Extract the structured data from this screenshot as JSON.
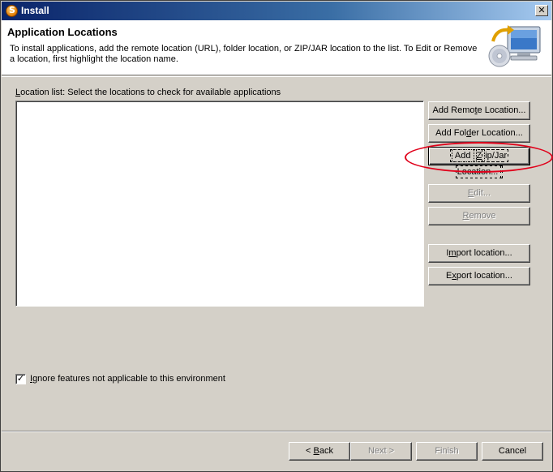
{
  "window": {
    "title": "Install"
  },
  "header": {
    "title": "Application Locations",
    "description": "To install applications, add the remote location (URL), folder location, or ZIP/JAR location to the list. To Edit or Remove a location, first highlight the location name."
  },
  "location_list": {
    "label_mnemonic": "L",
    "label_rest": "ocation list: Select the locations to check for available applications",
    "items": []
  },
  "buttons": {
    "add_remote": {
      "before": "Add Remo",
      "mnemonic": "t",
      "after": "e Location..."
    },
    "add_folder": {
      "before": "Add Fol",
      "mnemonic": "d",
      "after": "er Location..."
    },
    "add_zip": {
      "before": "Add ",
      "mnemonic": "Z",
      "after": "ip/Jar Location..."
    },
    "edit": {
      "mnemonic": "E",
      "after": "dit..."
    },
    "remove": {
      "mnemonic": "R",
      "after": "emove"
    },
    "import": {
      "before": "I",
      "mnemonic": "m",
      "after": "port location..."
    },
    "export": {
      "before": "E",
      "mnemonic": "x",
      "after": "port location..."
    }
  },
  "ignore_features": {
    "checked": true,
    "check_mark": "✓",
    "mnemonic": "I",
    "label_rest": "gnore features not applicable to this environment"
  },
  "footer": {
    "back": {
      "before": "< ",
      "mnemonic": "B",
      "after": "ack"
    },
    "next": "Next >",
    "finish": "Finish",
    "cancel": "Cancel"
  },
  "icons": {
    "app": "app-logo-icon",
    "close": "close-icon",
    "wizard": "install-wizard-icon"
  },
  "colors": {
    "titlebar_start": "#0a246a",
    "titlebar_end": "#a6caf0",
    "dialog_bg": "#d4d0c8",
    "annotation": "#e0001a"
  }
}
